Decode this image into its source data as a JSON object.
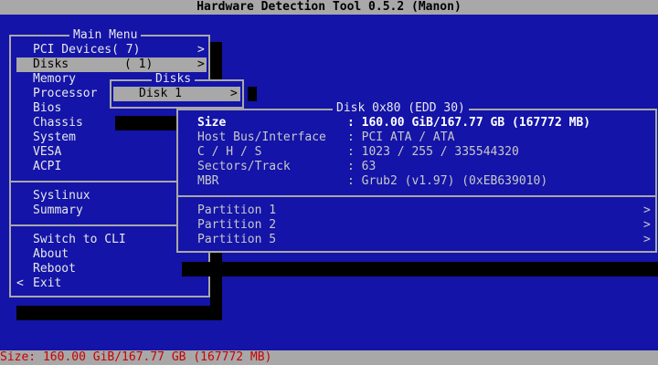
{
  "title": "Hardware Detection Tool 0.5.2 (Manon)",
  "main_menu": {
    "title": "Main Menu",
    "items": [
      {
        "label": "PCI Devices( 7)",
        "arrow": ">"
      },
      {
        "label": "Disks",
        "count": "( 1)",
        "arrow": ">"
      },
      {
        "label": "Memory"
      },
      {
        "label": "Processor"
      },
      {
        "label": "Bios"
      },
      {
        "label": "Chassis"
      },
      {
        "label": "System"
      },
      {
        "label": "VESA"
      },
      {
        "label": "ACPI"
      },
      {
        "label": "Syslinux"
      },
      {
        "label": "Summary"
      },
      {
        "label": "Switch to CLI"
      },
      {
        "label": "About"
      },
      {
        "label": "Reboot"
      },
      {
        "label": "Exit",
        "prefix": "<"
      }
    ]
  },
  "disks_menu": {
    "title": "Disks",
    "item": "Disk 1",
    "arrow": ">"
  },
  "disk_panel": {
    "title": "Disk 0x80 (EDD 30)",
    "fields": [
      {
        "label": "Size",
        "value": ": 160.00 GiB/167.77 GB (167772 MB)"
      },
      {
        "label": "Host Bus/Interface",
        "value": ": PCI ATA / ATA"
      },
      {
        "label": "C / H / S",
        "value": ": 1023 / 255 / 335544320"
      },
      {
        "label": "Sectors/Track",
        "value": ": 63"
      },
      {
        "label": "MBR",
        "value": ": Grub2 (v1.97) (0xEB639010)"
      }
    ],
    "partitions": [
      {
        "label": "Partition 1",
        "arrow": ">"
      },
      {
        "label": "Partition 2",
        "arrow": ">"
      },
      {
        "label": "Partition 5",
        "arrow": ">"
      }
    ]
  },
  "status": "Size: 160.00 GiB/167.77 GB (167772 MB)",
  "colors": {
    "background": "#1414a8",
    "bar": "#a8a8a8",
    "status_text": "#c80000",
    "shadow": "#000000"
  }
}
